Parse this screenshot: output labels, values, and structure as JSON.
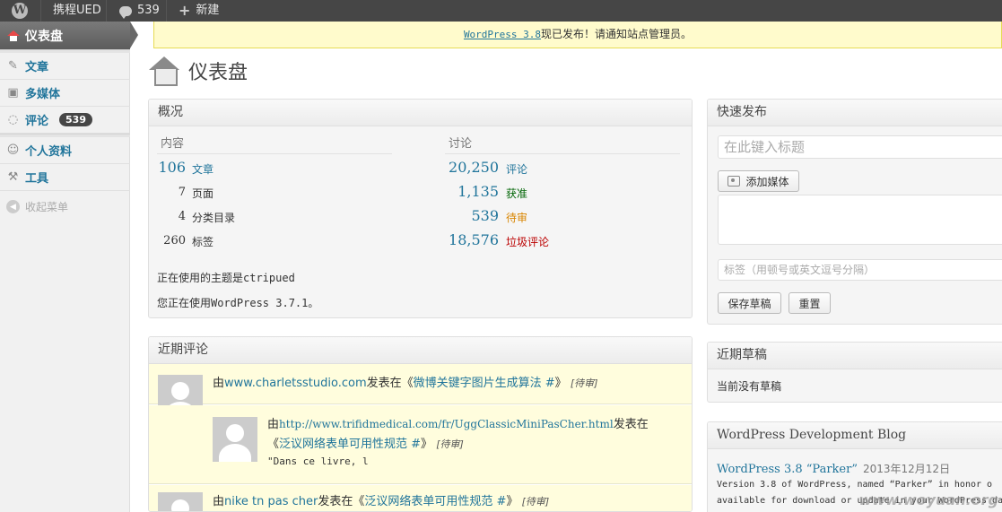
{
  "adminbar": {
    "logo": "W",
    "site_name": "携程UED",
    "comments_count": "539",
    "new_label": "新建"
  },
  "sidebar": {
    "current": "仪表盘",
    "items": [
      {
        "label": "文章",
        "icon": "pin-icon"
      },
      {
        "label": "多媒体",
        "icon": "media-icon"
      },
      {
        "label": "评论",
        "icon": "comment-icon",
        "badge": "539"
      },
      {
        "label": "个人资料",
        "icon": "users-icon"
      },
      {
        "label": "工具",
        "icon": "tools-icon"
      }
    ],
    "collapse_label": "收起菜单"
  },
  "notice": {
    "link": "WordPress 3.8",
    "text": "现已发布！请通知站点管理员。"
  },
  "page": {
    "title": "仪表盘"
  },
  "right_now": {
    "title": "概况",
    "content_head": "内容",
    "discussion_head": "讨论",
    "content_rows": [
      {
        "num": "106",
        "label": "文章"
      },
      {
        "num": "7",
        "label": "页面"
      },
      {
        "num": "4",
        "label": "分类目录"
      },
      {
        "num": "260",
        "label": "标签"
      }
    ],
    "discussion_rows": [
      {
        "num": "20,250",
        "label": "评论"
      },
      {
        "num": "1,135",
        "label": "获准"
      },
      {
        "num": "539",
        "label": "待审"
      },
      {
        "num": "18,576",
        "label": "垃圾评论"
      }
    ],
    "theme_text": "正在使用的主题是ctripued",
    "version_text": "您正在使用WordPress 3.7.1。"
  },
  "recent_comments": {
    "title": "近期评论",
    "items": [
      {
        "prefix": "由",
        "author": "www.charletsstudio.com",
        "mid": "发表在《",
        "post": "微博关键字图片生成算法 #",
        "suffix": "》",
        "status": "[待审]"
      },
      {
        "prefix": "由",
        "author": "http://www.trifidmedical.com/fr/UggClassicMiniPasCher.html",
        "mid": "发表在",
        "post_open": "《",
        "post": "泛议网络表单可用性规范 #",
        "suffix": "》",
        "status": "[待审]",
        "excerpt": "\"Dans ce livre, l"
      },
      {
        "prefix": "由",
        "author": "nike tn pas cher",
        "mid": "发表在《",
        "post": "泛议网络表单可用性规范 #",
        "suffix": "》",
        "status": "[待审]"
      }
    ]
  },
  "quick_press": {
    "title": "快速发布",
    "title_placeholder": "在此键入标题",
    "add_media": "添加媒体",
    "tags_placeholder": "标签（用顿号或英文逗号分隔）",
    "save_draft": "保存草稿",
    "reset": "重置"
  },
  "drafts": {
    "title": "近期草稿",
    "empty": "当前没有草稿"
  },
  "dev_blog": {
    "title": "WordPress Development Blog",
    "post_title": "WordPress 3.8 “Parker”",
    "post_date": "2013年12月12日",
    "line1": "Version 3.8 of WordPress, named “Parker” in honor o",
    "line2": "available for download or update in your WordPress da"
  },
  "watermark": "www.woyuan.org"
}
